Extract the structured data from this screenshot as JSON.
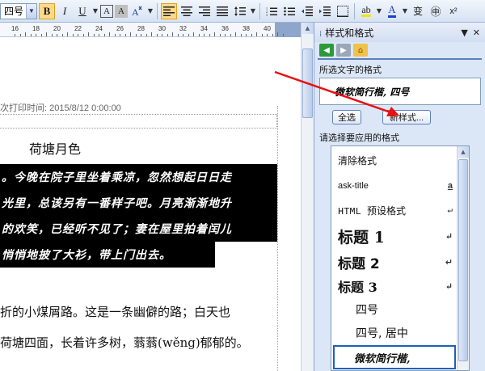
{
  "toolbar": {
    "font_size": "四号",
    "buttons": {
      "bold": "B",
      "italic": "I",
      "underline": "U",
      "char_border": "A",
      "char_shading": "A",
      "highlight": "A",
      "font_color": "A",
      "phonetic": "变",
      "enclosed": "㊥",
      "superscript": "x²"
    }
  },
  "ruler": {
    "ticks": [
      "16",
      "18",
      "20",
      "22",
      "24",
      "26",
      "28",
      "30",
      "32",
      "34",
      "36",
      "38",
      "40"
    ]
  },
  "document": {
    "header_text": "次打印时间: 2015/8/12 0:00:00",
    "title": "荷塘月色",
    "selected_lines": [
      "。今晚在院子里坐着乘凉，忽然想起日日走",
      "光里，总该另有一番样子吧。月亮渐渐地升",
      "的欢笑，已经听不见了；妻在屋里拍着闰儿",
      "悄悄地披了大衫，带上门出去。"
    ],
    "body_lines": [
      "折的小煤屑路。这是一条幽僻的路；白天也",
      "荷塘四面，长着许多树，蓊蓊(wěng)郁郁的。"
    ]
  },
  "pane": {
    "title": "样式和格式",
    "selected_format_label": "所选文字的格式",
    "selected_format_value": "微软简行楷, 四号",
    "select_all_button": "全选",
    "new_style_button": "新样式...",
    "apply_label": "请选择要应用的格式",
    "styles": [
      {
        "name": "清除格式",
        "symbol": ""
      },
      {
        "name": "ask-title",
        "symbol": "a"
      },
      {
        "name": "HTML 预设格式",
        "symbol": "↵"
      },
      {
        "name": "标题 1",
        "symbol": "↵"
      },
      {
        "name": "标题 2",
        "symbol": "↵"
      },
      {
        "name": "标题 3",
        "symbol": "↵"
      },
      {
        "name": "四号",
        "symbol": ""
      },
      {
        "name": "四号, 居中",
        "symbol": ""
      },
      {
        "name": "微软简行楷,",
        "symbol": ""
      }
    ]
  },
  "colors": {
    "annotation_arrow": "#e81010",
    "pane_bg": "#dbe6f6",
    "selection_bg": "#000000",
    "selected_border": "#1d5fbf"
  }
}
